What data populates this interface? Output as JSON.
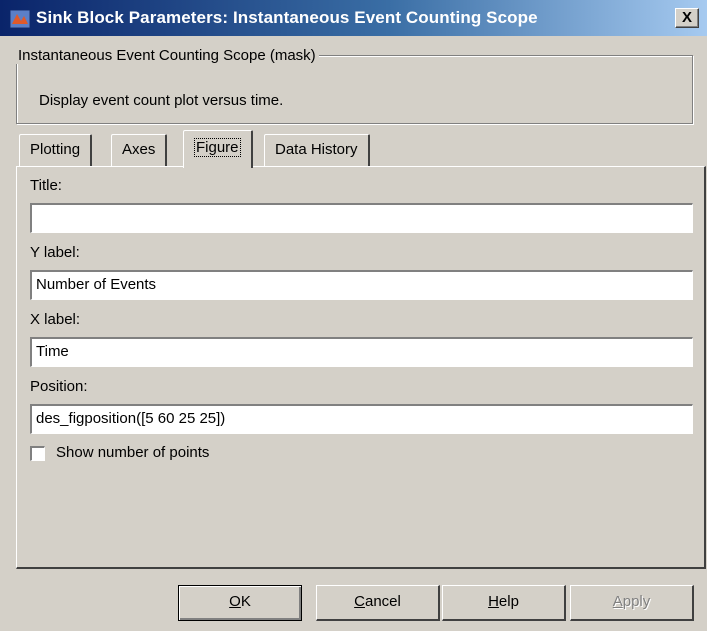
{
  "window": {
    "title": "Sink Block Parameters: Instantaneous Event Counting Scope",
    "close_glyph": "X"
  },
  "mask": {
    "group_label": "Instantaneous Event Counting Scope (mask)",
    "description": "Display event count plot versus time."
  },
  "tabs": [
    {
      "label": "Plotting",
      "active": false
    },
    {
      "label": "Axes",
      "active": false
    },
    {
      "label": "Figure",
      "active": true
    },
    {
      "label": "Data History",
      "active": false
    }
  ],
  "form": {
    "title_label": "Title:",
    "title_value": "",
    "ylabel_label": "Y label:",
    "ylabel_value": "Number of Events",
    "xlabel_label": "X label:",
    "xlabel_value": "Time",
    "position_label": "Position:",
    "position_value": "des_figposition([5 60 25 25])",
    "show_points_label": "Show number of points",
    "show_points_checked": false
  },
  "buttons": {
    "ok": {
      "mnemonic": "O",
      "rest": "K"
    },
    "cancel": {
      "mnemonic": "C",
      "rest": "ancel"
    },
    "help": {
      "mnemonic": "H",
      "rest": "elp"
    },
    "apply": {
      "mnemonic": "A",
      "rest": "pply",
      "disabled": true
    }
  },
  "colors": {
    "titlebar_start": "#0a246a",
    "titlebar_end": "#a6caf0",
    "dialog_face": "#d4d0c8"
  },
  "icons": {
    "app": "simulink-block-icon",
    "close": "close-icon"
  }
}
